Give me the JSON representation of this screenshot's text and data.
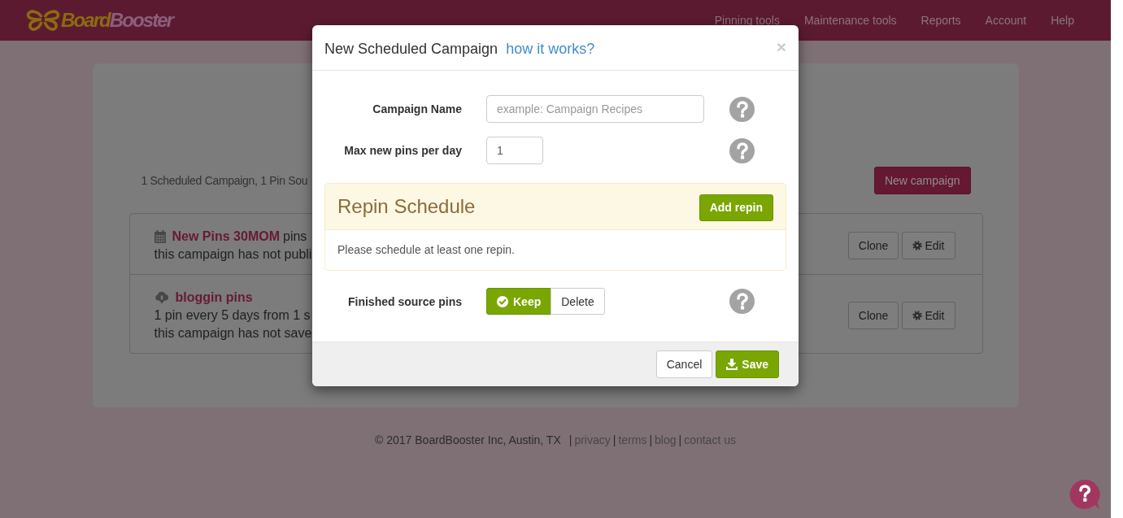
{
  "navbar": {
    "logo": {
      "part_1": "Board",
      "part_2": "Booster"
    },
    "links": [
      "Pinning tools",
      "Maintenance tools",
      "Reports",
      "Account",
      "Help"
    ]
  },
  "page": {
    "summary": "1 Scheduled Campaign, 1 Pin Sou",
    "new_campaign_button": "New campaign",
    "campaigns": [
      {
        "kind": "scheduled",
        "name": "New Pins 30MOM",
        "inline_text": "pins",
        "lines": [
          "this campaign has not publi"
        ],
        "buttons": [
          {
            "kind": "clone",
            "label": "Clone"
          },
          {
            "kind": "edit",
            "label": "Edit"
          }
        ]
      },
      {
        "kind": "pin_source",
        "name": "bloggin pins",
        "lines": [
          "1 pin every 5 days from 1 s",
          "this campaign has not save"
        ],
        "buttons": [
          {
            "kind": "clone",
            "label": "Clone"
          },
          {
            "kind": "edit",
            "label": "Edit"
          }
        ]
      }
    ]
  },
  "footer": {
    "copyright": "© 2017 BoardBooster Inc, Austin, TX",
    "separator": "|",
    "links": [
      "privacy",
      "terms",
      "blog",
      "contact us"
    ]
  },
  "modal": {
    "title": "New Scheduled Campaign",
    "help_link": "how it works?",
    "close": "×",
    "fields": [
      {
        "kind": "text",
        "label": "Campaign Name",
        "placeholder": "example: Campaign Recipes"
      },
      {
        "kind": "number",
        "label": "Max new pins per day",
        "value": "1"
      }
    ],
    "repin_schedule": {
      "title": "Repin Schedule",
      "add_button": "Add repin",
      "empty_message": "Please schedule at least one repin."
    },
    "finished_source_pins": {
      "label": "Finished source pins",
      "options": [
        {
          "label": "Keep",
          "selected": true
        },
        {
          "label": "Delete",
          "selected": false
        }
      ]
    },
    "buttons": [
      {
        "kind": "cancel",
        "label": "Cancel"
      },
      {
        "kind": "save",
        "label": "Save"
      }
    ]
  }
}
